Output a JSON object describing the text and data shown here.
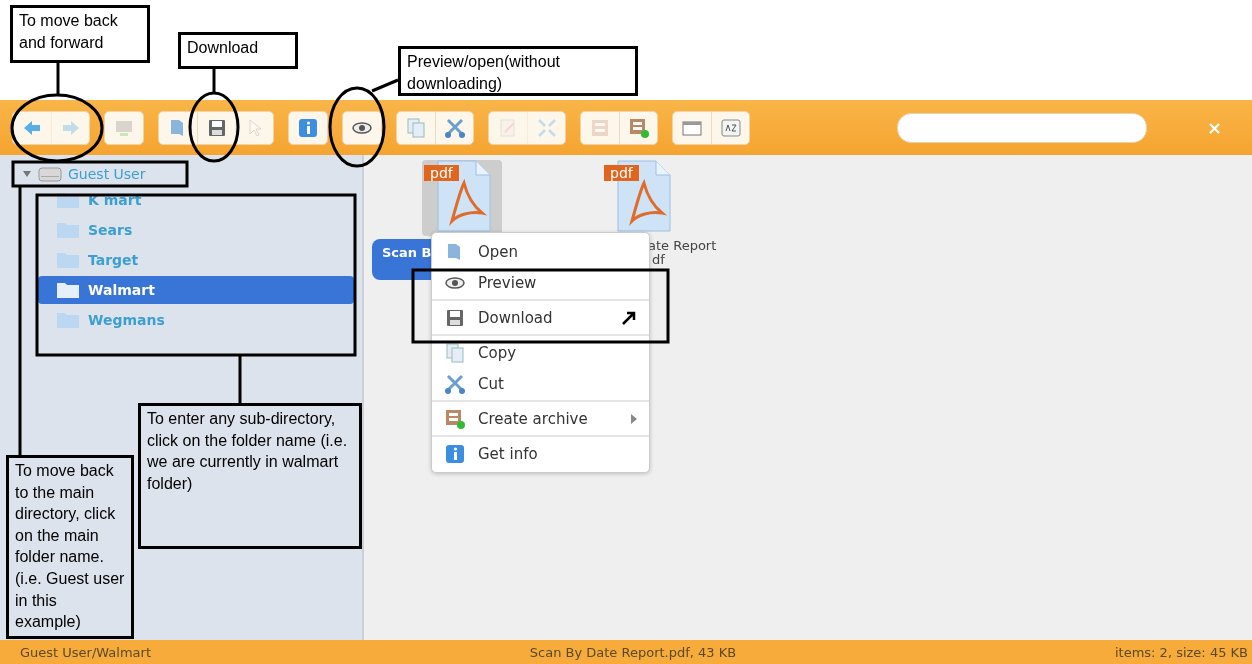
{
  "callouts": [
    {
      "text": "To move back and forward"
    },
    {
      "text": "Download"
    },
    {
      "text": "Preview/open(without downloading)"
    },
    {
      "text": "To enter any sub-directory, click on the folder name (i.e. we are currently in walmart folder)"
    },
    {
      "text": "To move back to the main directory, click on the main folder name.(i.e. Guest user in this example)"
    }
  ],
  "toolbar": {
    "groups": [
      [
        {
          "kind": "back",
          "disabled": false
        },
        {
          "kind": "forward",
          "disabled": true
        }
      ],
      [
        {
          "kind": "drive",
          "disabled": true
        }
      ],
      [
        {
          "kind": "open",
          "disabled": false
        },
        {
          "kind": "download",
          "disabled": false
        },
        {
          "kind": "select",
          "disabled": true
        }
      ],
      [
        {
          "kind": "info",
          "disabled": false
        }
      ],
      [
        {
          "kind": "preview",
          "disabled": false
        }
      ],
      [
        {
          "kind": "copy",
          "disabled": false
        },
        {
          "kind": "cut",
          "disabled": false
        }
      ],
      [
        {
          "kind": "edit",
          "disabled": true
        },
        {
          "kind": "resize",
          "disabled": true
        }
      ],
      [
        {
          "kind": "extract",
          "disabled": true
        },
        {
          "kind": "archive",
          "disabled": false
        }
      ],
      [
        {
          "kind": "view",
          "disabled": false
        },
        {
          "kind": "sort",
          "disabled": false
        }
      ]
    ],
    "close": "×"
  },
  "tree": {
    "label": "Guest User",
    "expanded": true,
    "children": [
      {
        "label": "K mart",
        "selected": false
      },
      {
        "label": "Sears",
        "selected": false
      },
      {
        "label": "Target",
        "selected": false
      },
      {
        "label": "Walmart",
        "selected": true
      },
      {
        "label": "Wegmans",
        "selected": false
      }
    ]
  },
  "files": [
    {
      "badge": "pdf",
      "label": [
        "Scan B"
      ],
      "selected": true
    },
    {
      "badge": "pdf",
      "label": [
        "ate Report",
        "df"
      ],
      "selected": false
    }
  ],
  "context_menu": {
    "groups": [
      [
        {
          "kind": "open",
          "label": "Open",
          "submenu": false
        },
        {
          "kind": "preview",
          "label": "Preview",
          "submenu": false
        }
      ],
      [
        {
          "kind": "download",
          "label": "Download",
          "submenu": false
        }
      ],
      [
        {
          "kind": "copy",
          "label": "Copy",
          "submenu": false
        },
        {
          "kind": "cut",
          "label": "Cut",
          "submenu": false
        }
      ],
      [
        {
          "kind": "archive",
          "label": "Create archive",
          "submenu": true
        }
      ],
      [
        {
          "kind": "info",
          "label": "Get info",
          "submenu": false
        }
      ]
    ]
  },
  "status_bar": {
    "path": "Guest User/Walmart",
    "selection": "Scan By Date Report.pdf, 43 KB",
    "summary": "items: 2, size: 45 KB"
  }
}
